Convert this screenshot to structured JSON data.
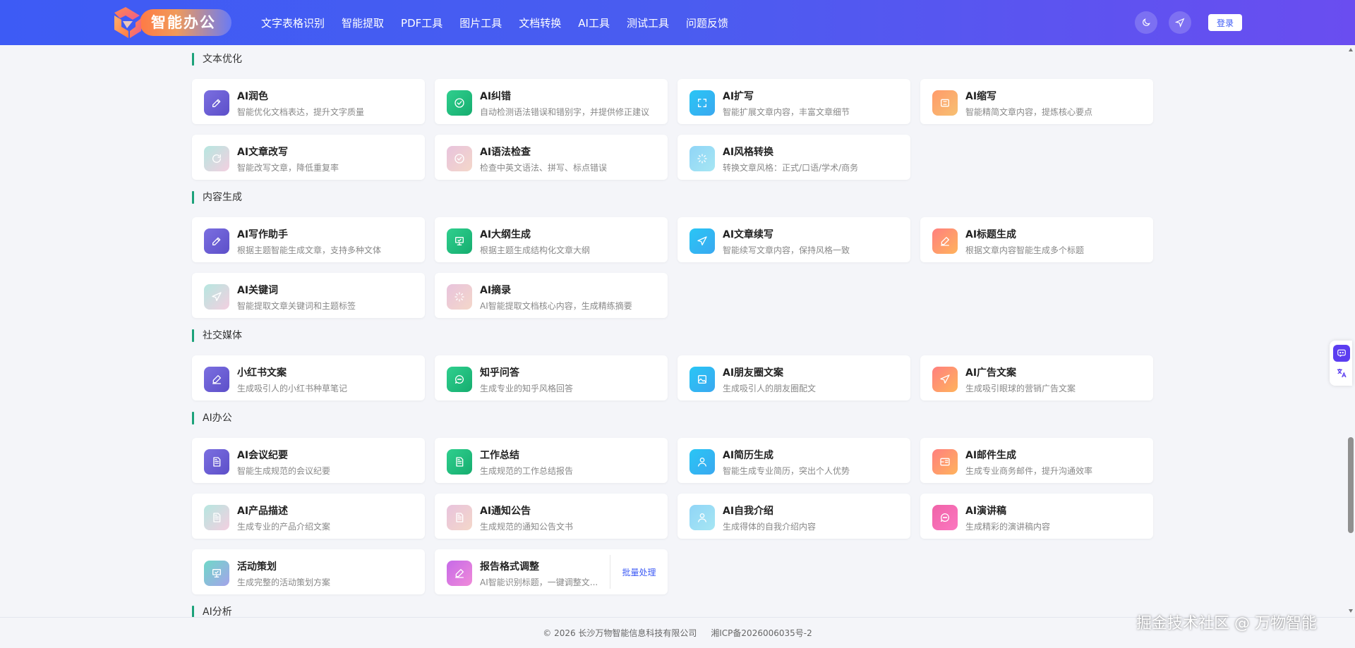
{
  "header": {
    "logo_text": "智能办公",
    "nav": [
      "文字表格识别",
      "智能提取",
      "PDF工具",
      "图片工具",
      "文档转换",
      "AI工具",
      "测试工具",
      "问题反馈"
    ],
    "icons": [
      "moon-icon",
      "send-icon"
    ],
    "login_label": "登录"
  },
  "sections": [
    {
      "title": "文本优化",
      "cards": [
        {
          "title": "AI润色",
          "desc": "智能优化文档表达，提升文字质量",
          "icon": "edit-icon",
          "style": "g-purple"
        },
        {
          "title": "AI纠错",
          "desc": "自动检测语法错误和错别字，并提供修正建议",
          "icon": "check-circle-icon",
          "style": "g-green"
        },
        {
          "title": "AI扩写",
          "desc": "智能扩展文章内容，丰富文章细节",
          "icon": "expand-icon",
          "style": "g-cyan"
        },
        {
          "title": "AI缩写",
          "desc": "智能精简文章内容，提炼核心要点",
          "icon": "compress-icon",
          "style": "g-orange"
        },
        {
          "title": "AI文章改写",
          "desc": "智能改写文章，降低重复率",
          "icon": "refresh-icon",
          "style": "g-pastel1"
        },
        {
          "title": "AI语法检查",
          "desc": "检查中英文语法、拼写、标点错误",
          "icon": "check-circle-icon",
          "style": "g-pastel2"
        },
        {
          "title": "AI风格转换",
          "desc": "转换文章风格：正式/口语/学术/商务",
          "icon": "loader-icon",
          "style": "g-pastel3"
        }
      ]
    },
    {
      "title": "内容生成",
      "cards": [
        {
          "title": "AI写作助手",
          "desc": "根据主题智能生成文章，支持多种文体",
          "icon": "edit-icon",
          "style": "g-purple"
        },
        {
          "title": "AI大纲生成",
          "desc": "根据主题生成结构化文章大纲",
          "icon": "presentation-icon",
          "style": "g-green"
        },
        {
          "title": "AI文章续写",
          "desc": "智能续写文章内容，保持风格一致",
          "icon": "send-icon",
          "style": "g-cyan"
        },
        {
          "title": "AI标题生成",
          "desc": "根据文章内容智能生成多个标题",
          "icon": "pen-icon",
          "style": "g-orange2"
        },
        {
          "title": "AI关键词",
          "desc": "智能提取文章关键词和主题标签",
          "icon": "send-icon",
          "style": "g-pastel1"
        },
        {
          "title": "AI摘录",
          "desc": "AI智能提取文档核心内容，生成精练摘要",
          "icon": "loader-icon",
          "style": "g-pastel2"
        }
      ]
    },
    {
      "title": "社交媒体",
      "cards": [
        {
          "title": "小红书文案",
          "desc": "生成吸引人的小红书种草笔记",
          "icon": "pen-icon",
          "style": "g-purple"
        },
        {
          "title": "知乎问答",
          "desc": "生成专业的知乎风格回答",
          "icon": "chat-icon",
          "style": "g-green"
        },
        {
          "title": "AI朋友圈文案",
          "desc": "生成吸引人的朋友圈配文",
          "icon": "image-icon",
          "style": "g-cyan"
        },
        {
          "title": "AI广告文案",
          "desc": "生成吸引眼球的营销广告文案",
          "icon": "send-icon",
          "style": "g-orange2"
        }
      ]
    },
    {
      "title": "AI办公",
      "cards": [
        {
          "title": "AI会议纪要",
          "desc": "智能生成规范的会议纪要",
          "icon": "document-icon",
          "style": "g-purple"
        },
        {
          "title": "工作总结",
          "desc": "生成规范的工作总结报告",
          "icon": "document-icon",
          "style": "g-green"
        },
        {
          "title": "AI简历生成",
          "desc": "智能生成专业简历，突出个人优势",
          "icon": "user-icon",
          "style": "g-cyan"
        },
        {
          "title": "AI邮件生成",
          "desc": "生成专业商务邮件，提升沟通效率",
          "icon": "mail-icon",
          "style": "g-orange2"
        },
        {
          "title": "AI产品描述",
          "desc": "生成专业的产品介绍文案",
          "icon": "document-icon",
          "style": "g-pastel1"
        },
        {
          "title": "AI通知公告",
          "desc": "生成规范的通知公告文书",
          "icon": "document-icon",
          "style": "g-pastel2"
        },
        {
          "title": "AI自我介绍",
          "desc": "生成得体的自我介绍内容",
          "icon": "user-icon",
          "style": "g-pastel3"
        },
        {
          "title": "AI演讲稿",
          "desc": "生成精彩的演讲稿内容",
          "icon": "chat-icon",
          "style": "g-pink"
        },
        {
          "title": "活动策划",
          "desc": "生成完整的活动策划方案",
          "icon": "presentation-icon",
          "style": "g-teal"
        },
        {
          "title": "报告格式调整",
          "desc": "AI智能识别标题，一键调整文...",
          "icon": "pen-icon",
          "style": "g-violet",
          "extra": "批量处理"
        }
      ]
    },
    {
      "title": "AI分析",
      "cards": []
    }
  ],
  "footer": {
    "copyright": "© 2026 长沙万物智能信息科技有限公司",
    "icp": "湘ICP备2026006035号-2"
  },
  "watermark": "掘金技术社区 @ 万物智能",
  "side_float": [
    "chat-bot-icon",
    "translate-icon"
  ]
}
